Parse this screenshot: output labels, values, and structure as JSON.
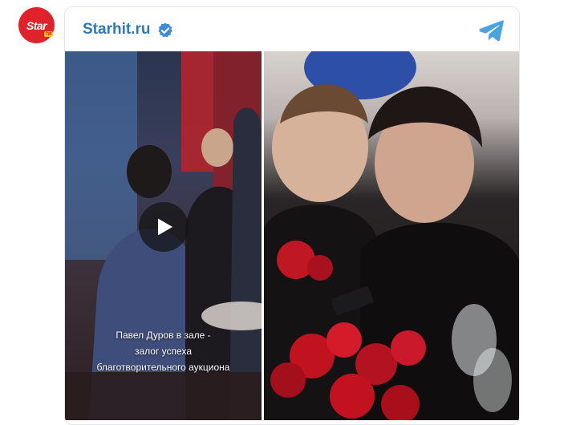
{
  "avatar": {
    "logo_main": "Star",
    "logo_sub": "hit"
  },
  "header": {
    "channel_name": "Starhit.ru"
  },
  "media": {
    "video": {
      "caption_lines": [
        "Павел Дуров в зале -",
        "залог успеха",
        "благотворительного аукциона"
      ]
    }
  },
  "colors": {
    "brand_red": "#e0232b",
    "channel_blue": "#2f78b7",
    "verified_blue": "#3d8bd8",
    "telegram_blue": "#4aa3df"
  },
  "icons": [
    "verified-badge-icon",
    "telegram-icon",
    "play-icon"
  ]
}
